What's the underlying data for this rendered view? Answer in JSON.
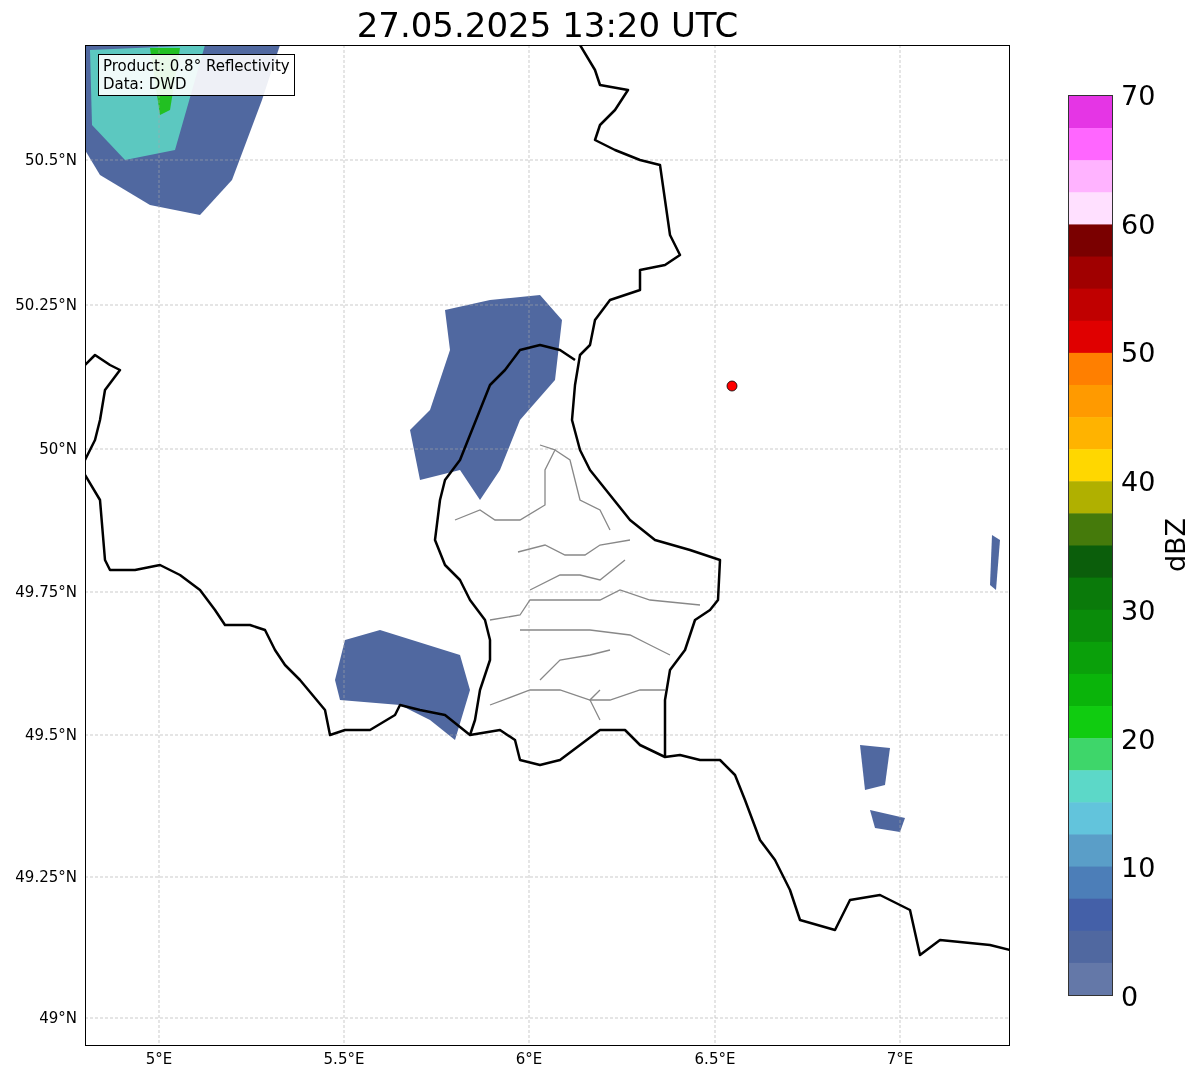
{
  "title": "27.05.2025 13:20 UTC",
  "map": {
    "info_lines": [
      "Product: 0.8° Reflectivity",
      "Data: DWD"
    ],
    "lat_labels": [
      "50.5°N",
      "50.25°N",
      "50°N",
      "49.75°N",
      "49.5°N",
      "49.25°N",
      "49°N"
    ],
    "lon_labels": [
      "5°E",
      "5.5°E",
      "6°E",
      "6.5°E",
      "7°E"
    ]
  },
  "colorbar": {
    "label": "dBZ",
    "ticks": [
      "70",
      "60",
      "50",
      "40",
      "30",
      "20",
      "10",
      "0"
    ],
    "bands": [
      {
        "color": "#e535e5"
      },
      {
        "color": "#ff66ff"
      },
      {
        "color": "#ffb3ff"
      },
      {
        "color": "#ffe0ff"
      },
      {
        "color": "#7a0000"
      },
      {
        "color": "#a00000"
      },
      {
        "color": "#c00000"
      },
      {
        "color": "#e00000"
      },
      {
        "color": "#ff7f00"
      },
      {
        "color": "#ff9a00"
      },
      {
        "color": "#ffb300"
      },
      {
        "color": "#ffd700"
      },
      {
        "color": "#b0b000"
      },
      {
        "color": "#457a0b"
      },
      {
        "color": "#0b5e0b"
      },
      {
        "color": "#0a7a0a"
      },
      {
        "color": "#0a8c0a"
      },
      {
        "color": "#0aa00a"
      },
      {
        "color": "#0ab40a"
      },
      {
        "color": "#10cc10"
      },
      {
        "color": "#3ed66a"
      },
      {
        "color": "#5cd8c8"
      },
      {
        "color": "#62c4dc"
      },
      {
        "color": "#5a9ec8"
      },
      {
        "color": "#4c7eb8"
      },
      {
        "color": "#4460a8"
      },
      {
        "color": "#5068a0"
      },
      {
        "color": "#6478a8"
      }
    ]
  }
}
